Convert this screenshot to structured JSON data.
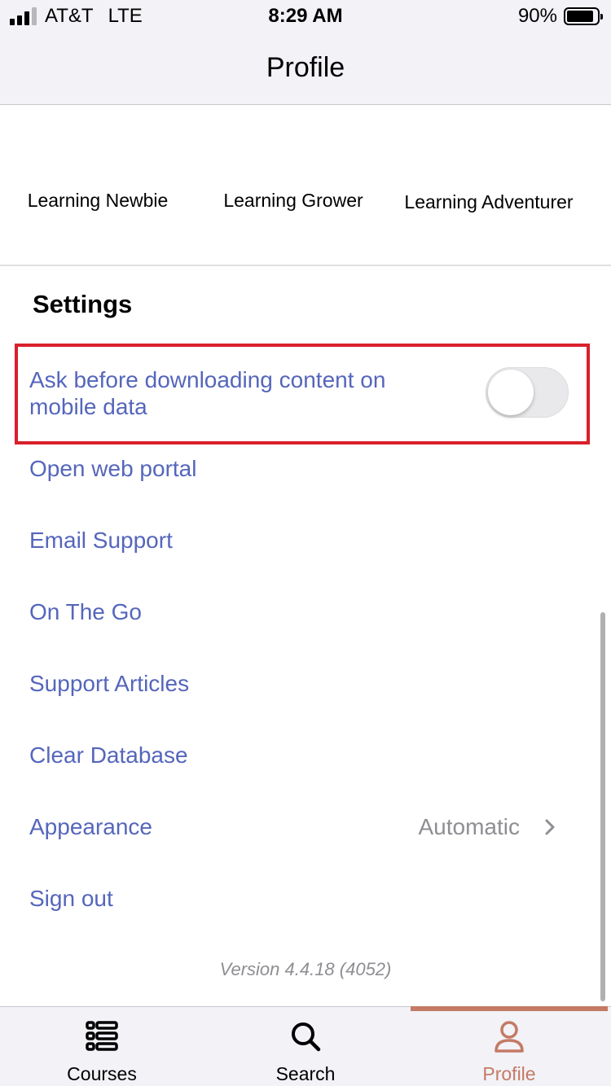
{
  "status_bar": {
    "carrier": "AT&T",
    "network": "LTE",
    "time": "8:29 AM",
    "battery": "90%"
  },
  "header": {
    "title": "Profile"
  },
  "badges": [
    {
      "label": "Learning Newbie"
    },
    {
      "label": "Learning Grower"
    },
    {
      "label": "Learning Adventurer"
    }
  ],
  "settings": {
    "title": "Settings",
    "ask_before_download": {
      "label": "Ask before downloading content on mobile data",
      "enabled": false
    },
    "items": [
      {
        "label": "Open web portal"
      },
      {
        "label": "Email Support"
      },
      {
        "label": "On The Go"
      },
      {
        "label": "Support Articles"
      },
      {
        "label": "Clear Database"
      },
      {
        "label": "Appearance",
        "value": "Automatic"
      },
      {
        "label": "Sign out"
      }
    ]
  },
  "version": "Version 4.4.18 (4052)",
  "tabbar": {
    "tabs": [
      {
        "label": "Courses",
        "icon": "courses-icon"
      },
      {
        "label": "Search",
        "icon": "search-icon"
      },
      {
        "label": "Profile",
        "icon": "profile-icon",
        "active": true
      }
    ]
  },
  "colors": {
    "link": "#5566bb",
    "accent": "#c47a64",
    "highlight": "#d9202b"
  }
}
